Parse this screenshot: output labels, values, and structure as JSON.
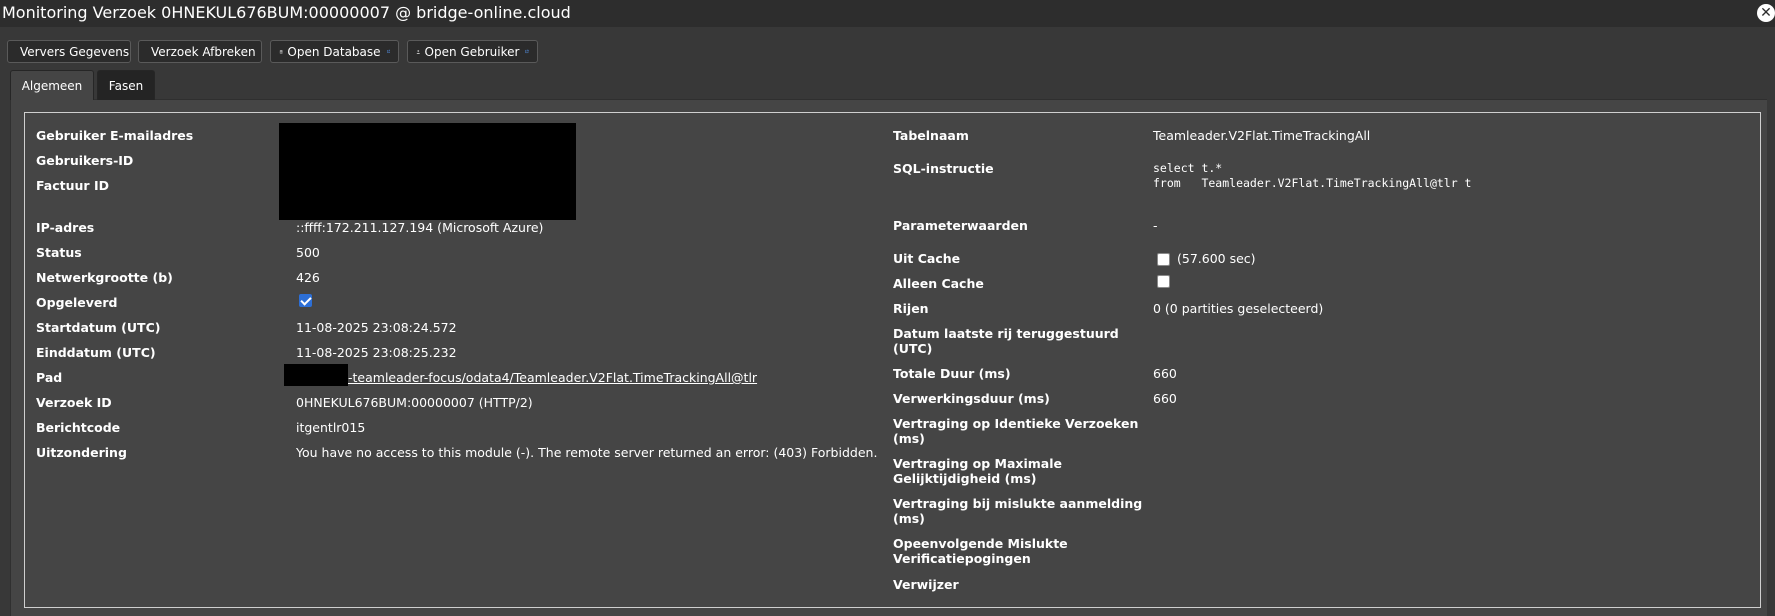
{
  "window": {
    "title": "Monitoring Verzoek 0HNEKUL676BUM:00000007 @ bridge-online.cloud",
    "close_icon": "close-icon",
    "close_glyph": "✕"
  },
  "toolbar": {
    "refresh": {
      "label": "Ververs Gegevens",
      "icon": "refresh-icon"
    },
    "abort": {
      "label": "Verzoek Afbreken",
      "icon": "cancel-icon"
    },
    "open_db": {
      "label": "Open Database",
      "icon": "database-icon",
      "ext_icon": "external-link-icon"
    },
    "open_user": {
      "label": "Open Gebruiker",
      "icon": "user-icon",
      "ext_icon": "external-link-icon"
    }
  },
  "tabs": [
    {
      "label": "Algemeen",
      "active": true
    },
    {
      "label": "Fasen",
      "active": false
    }
  ],
  "left": {
    "email_label": "Gebruiker E-mailadres",
    "userid_label": "Gebruikers-ID",
    "invoice_label": "Factuur ID",
    "ip_label": "IP-adres",
    "ip_value": "::ffff:172.211.127.194 (Microsoft Azure)",
    "status_label": "Status",
    "status_value": "500",
    "netsize_label": "Netwerkgrootte (b)",
    "netsize_value": "426",
    "delivered_label": "Opgeleverd",
    "delivered_checked": true,
    "start_label": "Startdatum (UTC)",
    "start_value": "11-08-2025 23:08:24.572",
    "end_label": "Einddatum (UTC)",
    "end_value": "11-08-2025 23:08:25.232",
    "path_label": "Pad",
    "path_value": "-teamleader-focus/odata4/Teamleader.V2Flat.TimeTrackingAll@tlr",
    "requestid_label": "Verzoek ID",
    "requestid_value": "0HNEKUL676BUM:00000007 (HTTP/2)",
    "msgcode_label": "Berichtcode",
    "msgcode_value": "itgentlr015",
    "exception_label": "Uitzondering",
    "exception_value": "You have no access to this module (-). The remote server returned an error: (403) Forbidden."
  },
  "right": {
    "table_label": "Tabelnaam",
    "table_value": "Teamleader.V2Flat.TimeTrackingAll",
    "sql_label": "SQL-instructie",
    "sql_line1": "select t.*",
    "sql_line2": "from   Teamleader.V2Flat.TimeTrackingAll@tlr t",
    "params_label": "Parameterwaarden",
    "params_value": "-",
    "fromcache_label": "Uit Cache",
    "fromcache_checked": false,
    "fromcache_value": "(57.600 sec)",
    "onlycache_label": "Alleen Cache",
    "onlycache_checked": false,
    "rows_label": "Rijen",
    "rows_value": "0 (0 partities geselecteerd)",
    "lastrow_label": "Datum laatste rij teruggestuurd (UTC)",
    "totaldur_label": "Totale Duur (ms)",
    "totaldur_value": "660",
    "procdur_label": "Verwerkingsduur (ms)",
    "procdur_value": "660",
    "delay_identical_label": "Vertraging op Identieke Verzoeken (ms)",
    "delay_max_label": "Vertraging op Maximale Gelijktijdigheid (ms)",
    "delay_failed_label": "Vertraging bij mislukte aanmelding (ms)",
    "failed_attempts_label": "Opeenvolgende Mislukte Verificatiepogingen",
    "referrer_label": "Verwijzer"
  }
}
